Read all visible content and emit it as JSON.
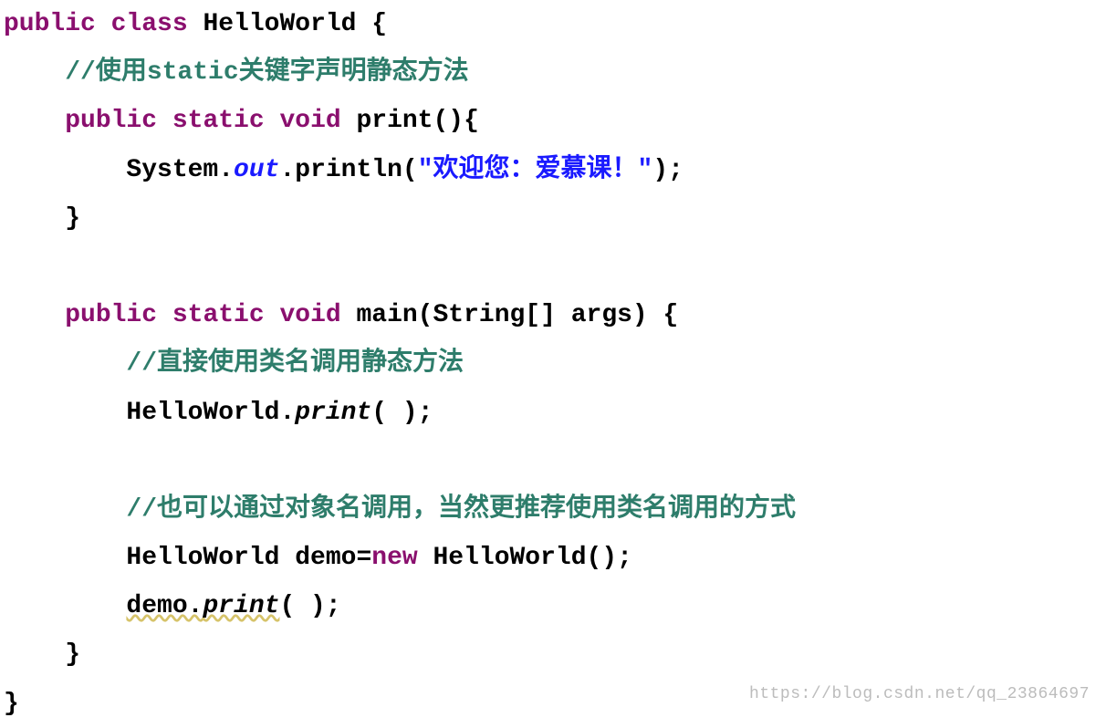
{
  "code": {
    "line1_kw1": "public class",
    "line1_name": " HelloWorld {",
    "line2_comment": "//使用static关键字声明静态方法",
    "line3_kw": "public static void",
    "line3_name": " print(){",
    "line4_pre": "System.",
    "line4_out": "out",
    "line4_mid": ".println(",
    "line4_str": "\"欢迎您：爱慕课！\"",
    "line4_post": ");",
    "line5": "}",
    "line6_kw": "public static void",
    "line6_name": " main(String[] args) {",
    "line7_comment": "//直接使用类名调用静态方法",
    "line8_pre": "HelloWorld.",
    "line8_call": "print",
    "line8_post": "( );",
    "line9_comment": "//也可以通过对象名调用，当然更推荐使用类名调用的方式",
    "line10_pre": "HelloWorld demo=",
    "line10_kw": "new",
    "line10_post": " HelloWorld();",
    "line11_pre": "demo.",
    "line11_call": "print",
    "line11_post": "( );",
    "line12": "}",
    "line13": "}"
  },
  "watermark": "https://blog.csdn.net/qq_23864697"
}
